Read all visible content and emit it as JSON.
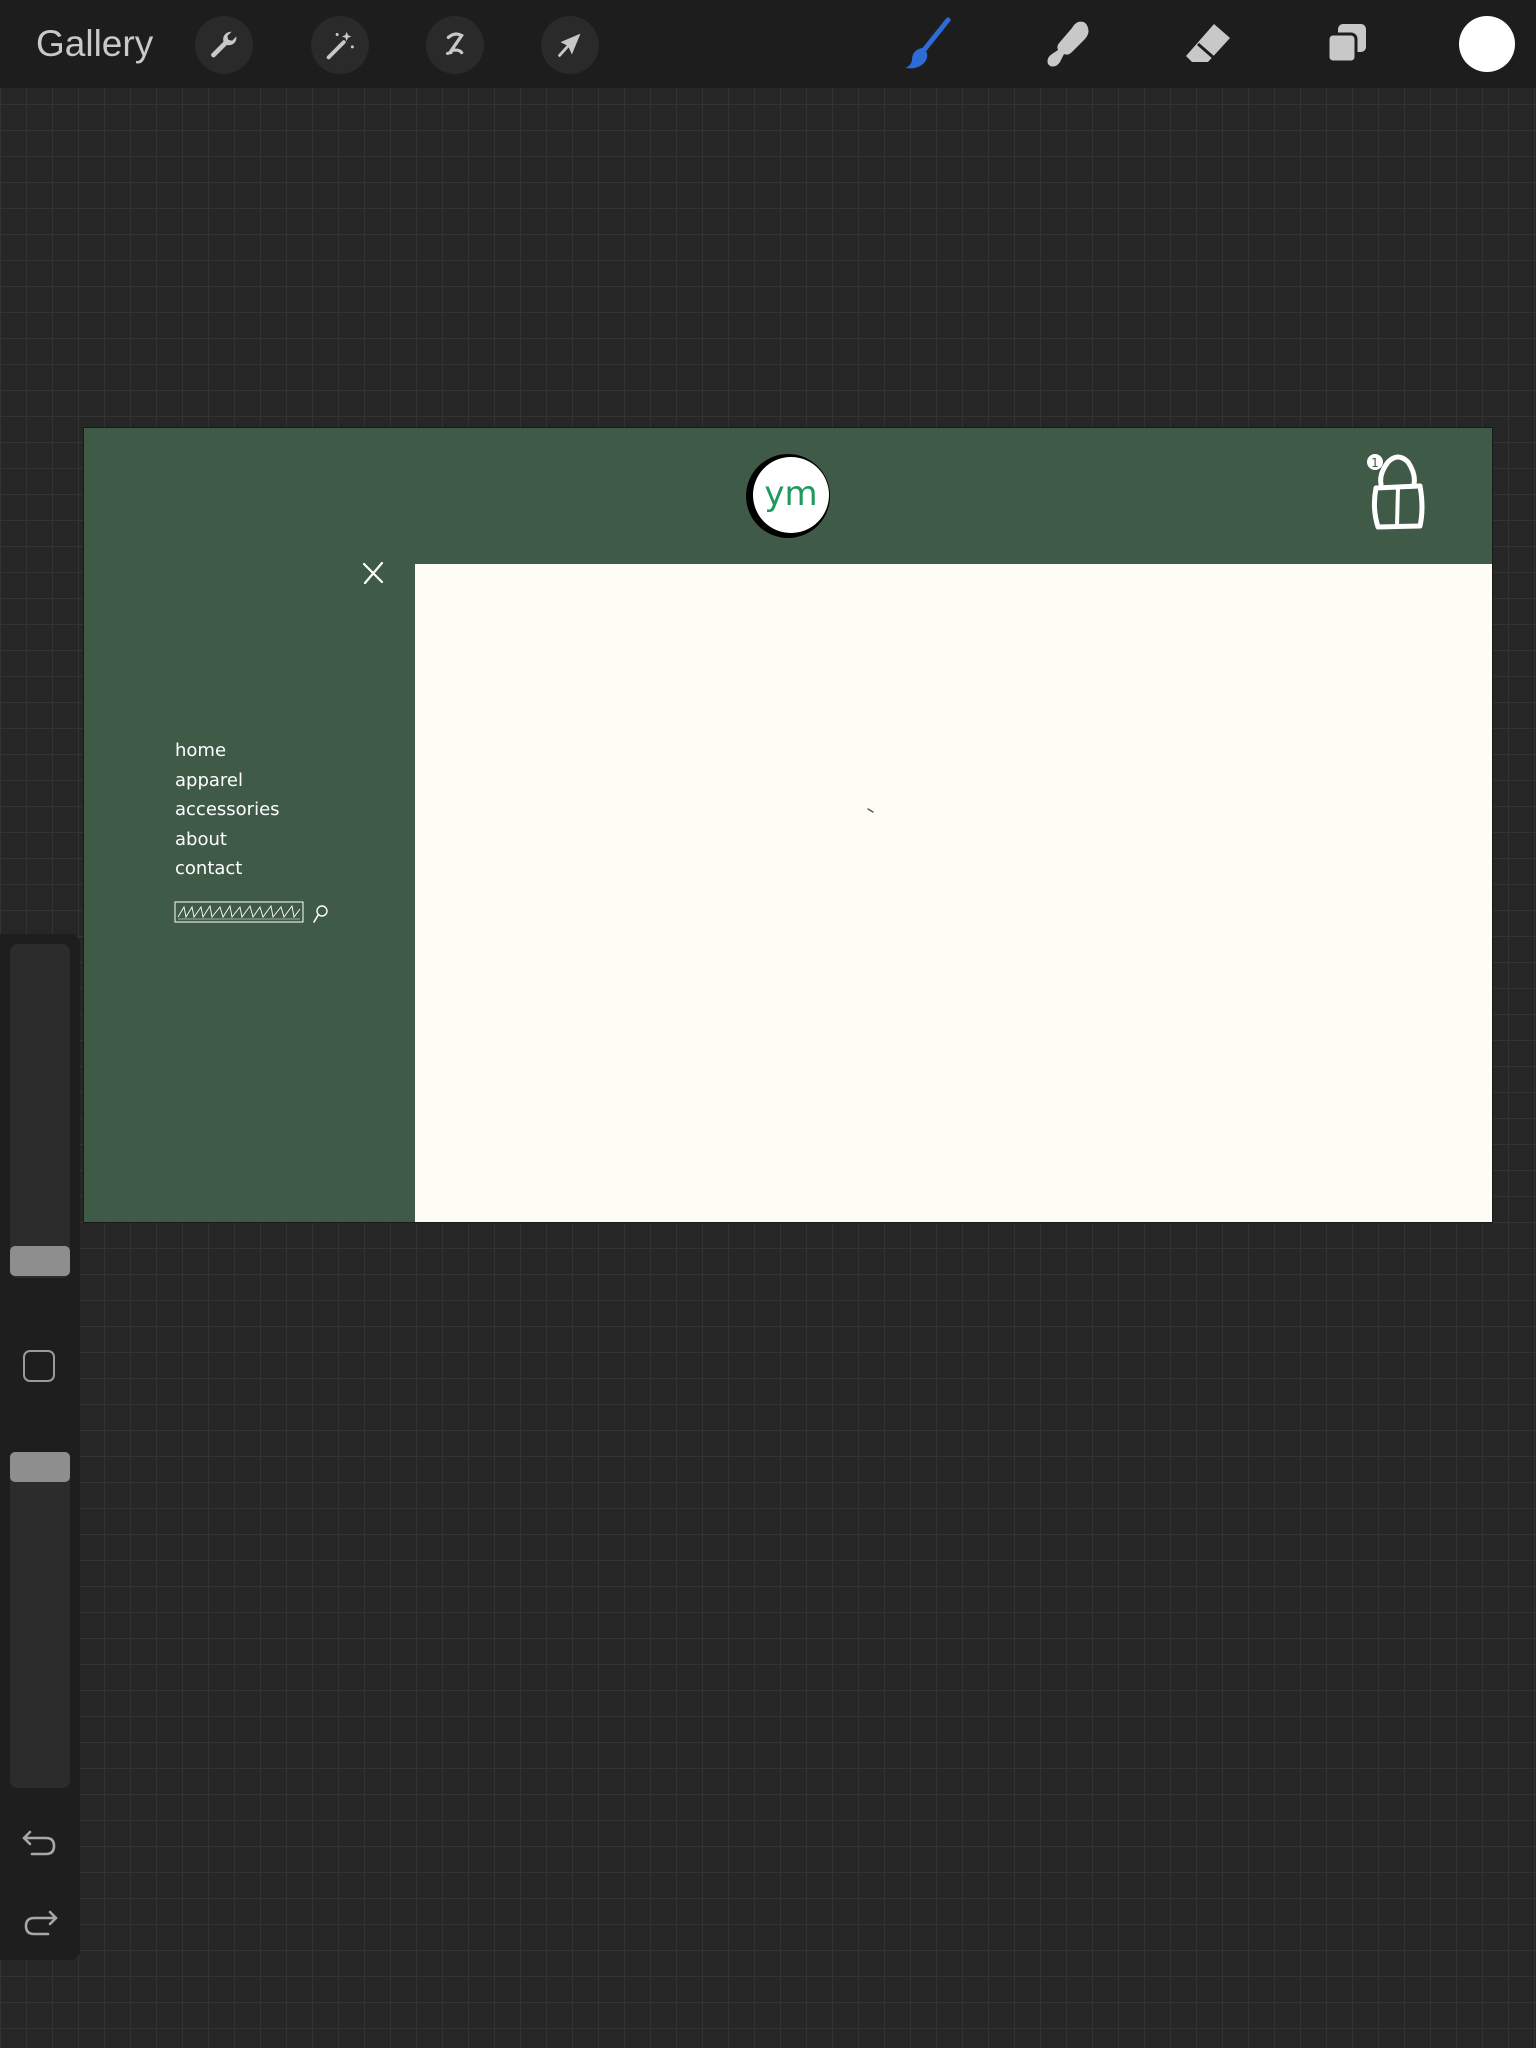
{
  "toolbar": {
    "gallery_label": "Gallery",
    "left_tools": [
      "wrench-icon",
      "magic-wand-icon",
      "selection-icon",
      "transform-arrow-icon"
    ],
    "right_tools": [
      "brush-icon",
      "smudge-icon",
      "eraser-icon",
      "layers-icon"
    ],
    "active_tool": "brush-icon",
    "accent_color": "#2f6bd6",
    "current_color": "#ffffff"
  },
  "sidebar": {
    "brush_size_level": 0.0,
    "opacity_level": 1.0,
    "icons": [
      "modify-square-icon",
      "undo-icon",
      "redo-icon"
    ]
  },
  "drawing": {
    "background_color": "#405a48",
    "content_color": "#fdfdf6",
    "logo_text": "ym",
    "logo_text_color": "#1e9a5c",
    "cart_count": "1",
    "nav_items": [
      "home",
      "apparel",
      "accessories",
      "about",
      "contact"
    ]
  }
}
